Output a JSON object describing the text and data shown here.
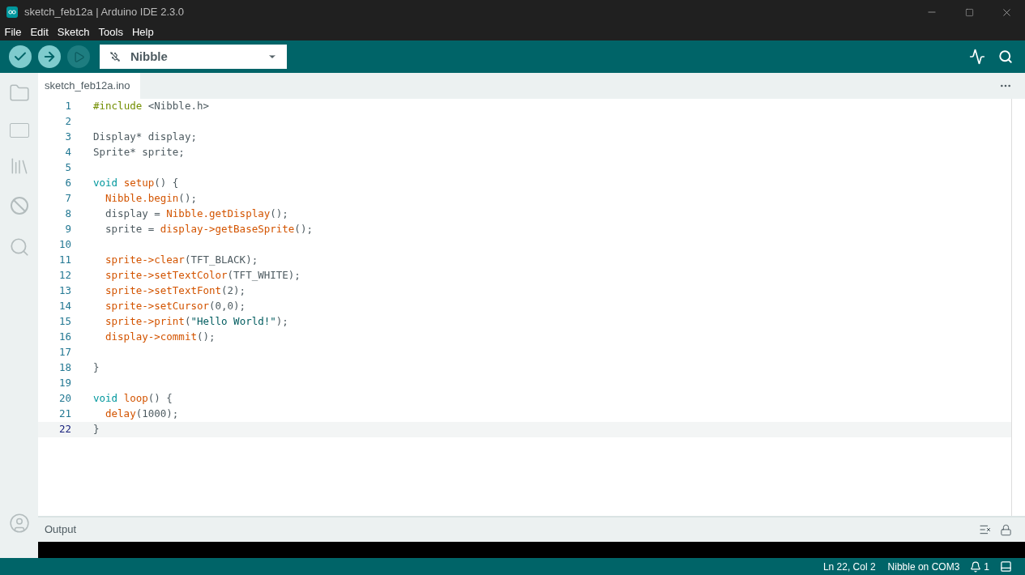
{
  "window": {
    "title": "sketch_feb12a | Arduino IDE 2.3.0"
  },
  "menu": [
    "File",
    "Edit",
    "Sketch",
    "Tools",
    "Help"
  ],
  "toolbar": {
    "board": "Nibble"
  },
  "tabs": [
    {
      "label": "sketch_feb12a.ino",
      "selected": true
    }
  ],
  "code_lines": [
    {
      "number": "1",
      "selected": false,
      "indent": false,
      "tokens": [
        {
          "kind": "directive",
          "text": "#include"
        },
        {
          "kind": "plain",
          "text": " <Nibble.h>"
        }
      ]
    },
    {
      "number": "2",
      "selected": false
    },
    {
      "number": "3",
      "selected": false,
      "indent": false,
      "tokens": [
        {
          "kind": "plain",
          "text": "Display* display;"
        }
      ]
    },
    {
      "number": "4",
      "selected": false,
      "indent": false,
      "tokens": [
        {
          "kind": "plain",
          "text": "Sprite* sprite;"
        }
      ]
    },
    {
      "number": "5",
      "selected": false
    },
    {
      "number": "6",
      "selected": false,
      "indent": false,
      "tokens": [
        {
          "kind": "keyword",
          "text": "void"
        },
        {
          "kind": "func",
          "text": "setup"
        },
        {
          "kind": "plain",
          "text": "() {"
        }
      ]
    },
    {
      "number": "7",
      "selected": false,
      "indent": true,
      "tokens": [
        {
          "kind": "func",
          "text": "Nibble.begin"
        },
        {
          "kind": "plain",
          "text": "();"
        }
      ]
    },
    {
      "number": "8",
      "selected": false,
      "indent": true,
      "tokens": [
        {
          "kind": "plain",
          "text": "display = "
        },
        {
          "kind": "func",
          "text": "Nibble.getDisplay"
        },
        {
          "kind": "plain",
          "text": "();"
        }
      ]
    },
    {
      "number": "9",
      "selected": false,
      "indent": true,
      "tokens": [
        {
          "kind": "plain",
          "text": "sprite = "
        },
        {
          "kind": "func",
          "text": "display->getBaseSprite"
        },
        {
          "kind": "plain",
          "text": "();"
        }
      ]
    },
    {
      "number": "10",
      "selected": false
    },
    {
      "number": "11",
      "selected": false,
      "indent": true,
      "tokens": [
        {
          "kind": "func",
          "text": "sprite->clear"
        },
        {
          "kind": "plain",
          "text": "(TFT_BLACK);"
        }
      ]
    },
    {
      "number": "12",
      "selected": false,
      "indent": true,
      "tokens": [
        {
          "kind": "func",
          "text": "sprite->setTextColor"
        },
        {
          "kind": "plain",
          "text": "(TFT_WHITE);"
        }
      ]
    },
    {
      "number": "13",
      "selected": false,
      "indent": true,
      "tokens": [
        {
          "kind": "func",
          "text": "sprite->setTextFont"
        },
        {
          "kind": "plain",
          "text": "(2);"
        }
      ]
    },
    {
      "number": "14",
      "selected": false,
      "indent": true,
      "tokens": [
        {
          "kind": "func",
          "text": "sprite->setCursor"
        },
        {
          "kind": "plain",
          "text": "(0,0);"
        }
      ]
    },
    {
      "number": "15",
      "selected": false,
      "indent": true,
      "tokens": [
        {
          "kind": "func",
          "text": "sprite->print"
        },
        {
          "kind": "plain",
          "text": "("
        },
        {
          "kind": "string",
          "text": "\"Hello World!\""
        },
        {
          "kind": "plain",
          "text": ");"
        }
      ]
    },
    {
      "number": "16",
      "selected": false,
      "indent": true,
      "tokens": [
        {
          "kind": "func",
          "text": "display->commit"
        },
        {
          "kind": "plain",
          "text": "();"
        }
      ]
    },
    {
      "number": "17",
      "selected": false
    },
    {
      "number": "18",
      "selected": false,
      "indent": false,
      "tokens": [
        {
          "kind": "plain",
          "text": "}"
        }
      ]
    },
    {
      "number": "19",
      "selected": false
    },
    {
      "number": "20",
      "selected": false,
      "indent": false,
      "tokens": [
        {
          "kind": "keyword",
          "text": "void"
        },
        {
          "kind": "func",
          "text": "loop"
        },
        {
          "kind": "plain",
          "text": "() {"
        }
      ]
    },
    {
      "number": "21",
      "selected": false,
      "indent": true,
      "tokens": [
        {
          "kind": "func",
          "text": "delay"
        },
        {
          "kind": "plain",
          "text": "(1000);"
        }
      ]
    },
    {
      "number": "22",
      "selected": true,
      "indent": false,
      "tokens": [
        {
          "kind": "plain",
          "text": "}"
        }
      ]
    }
  ],
  "output": {
    "title": "Output"
  },
  "status_bar": {
    "position": "Ln 22, Col 2",
    "board": "Nibble on COM3",
    "notifications": "1"
  }
}
